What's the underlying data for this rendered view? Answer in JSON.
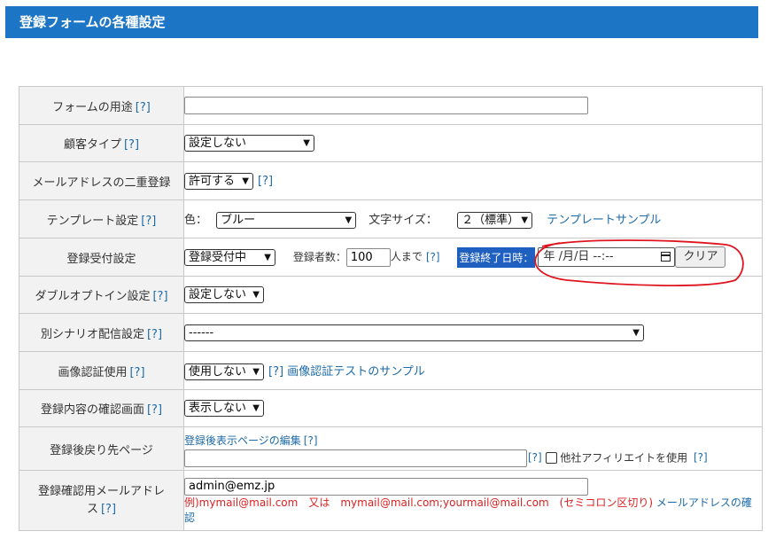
{
  "header": {
    "title": "登録フォームの各種設定"
  },
  "help": "[?]",
  "rows": {
    "purpose": {
      "label": "フォームの用途",
      "value": ""
    },
    "customer_type": {
      "label": "顧客タイプ",
      "select": "設定しない"
    },
    "dup_email": {
      "label": "メールアドレスの二重登録",
      "select": "許可する"
    },
    "template": {
      "label": "テンプレート設定",
      "color_label": "色：",
      "color_select": "ブルー",
      "font_label": "文字サイズ：",
      "font_select": "２（標準）",
      "sample_link": "テンプレートサンプル"
    },
    "reception": {
      "label": "登録受付設定",
      "status_select": "登録受付中",
      "count_label": "登録者数：",
      "count_value": "100",
      "count_unit": "人まで",
      "end_label": "登録終了日時：",
      "end_value": "年 /月/日 --:--",
      "clear_button": "クリア"
    },
    "double_optin": {
      "label": "ダブルオプトイン設定",
      "select": "設定しない"
    },
    "scenario": {
      "label": "別シナリオ配信設定",
      "select": "------"
    },
    "captcha": {
      "label": "画像認証使用",
      "select": "使用しない",
      "sample_link": "画像認証テストのサンプル"
    },
    "confirm_screen": {
      "label": "登録内容の確認画面",
      "select": "表示しない"
    },
    "redirect": {
      "label": "登録後戻り先ページ",
      "edit_link": "登録後表示ページの編集",
      "url_value": "",
      "affiliate_label": "他社アフィリエイトを使用"
    },
    "confirm_email": {
      "label_line1": "登録確認用メールアドレ",
      "label_line2": "ス",
      "value": "admin@emz.jp",
      "example": "例)mymail@mail.com　又は　mymail@mail.com;yourmail@mail.com　(セミコロン区切り)",
      "check_link_1": "メールアドレスの確",
      "check_link_2": "認"
    }
  },
  "colors": {
    "header_bg": "#1c76c5",
    "label_bg": "#f2f2f2",
    "link": "#1c6aa8",
    "badge": "#1f5fc0",
    "annotation": "#e0141e"
  }
}
